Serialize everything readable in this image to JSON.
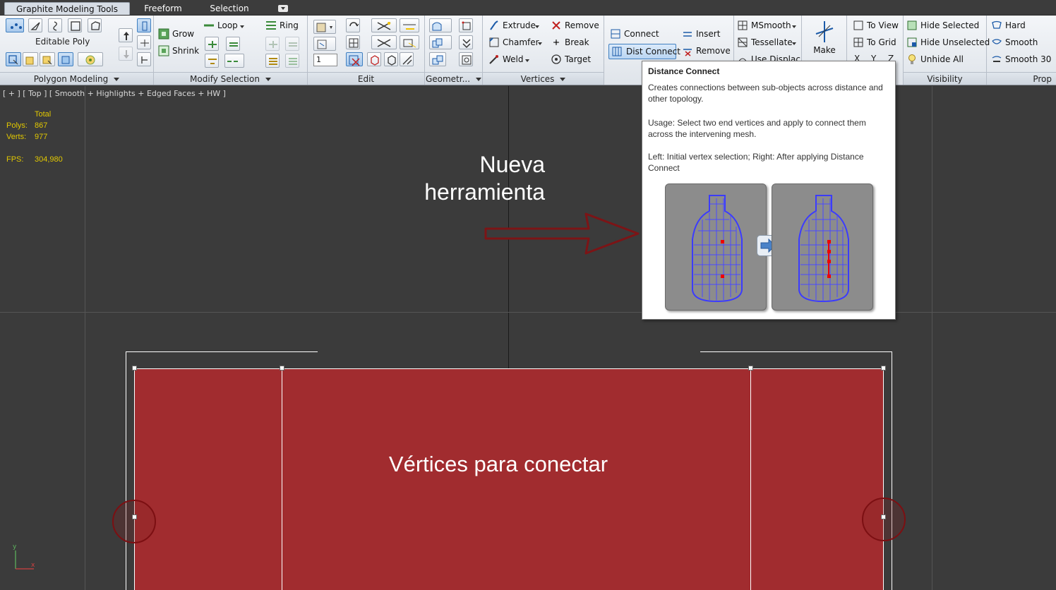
{
  "tabs": [
    {
      "label": "Graphite Modeling Tools",
      "active": true
    },
    {
      "label": "Freeform",
      "active": false
    },
    {
      "label": "Selection",
      "active": false
    }
  ],
  "ribbon": {
    "polygon_modeling": {
      "object_label": "Editable Poly",
      "footer": "Polygon Modeling"
    },
    "modify_selection": {
      "grow": "Grow",
      "shrink": "Shrink",
      "loop": "Loop",
      "ring": "Ring",
      "footer": "Modify Selection"
    },
    "edit": {
      "spinner_value": "1",
      "footer": "Edit"
    },
    "geometry": {
      "footer": "Geometr..."
    },
    "vertices": {
      "extrude": "Extrude",
      "chamfer": "Chamfer",
      "weld": "Weld",
      "remove": "Remove",
      "break": "Break",
      "target": "Target",
      "footer": "Vertices"
    },
    "loops": {
      "connect": "Connect",
      "dist_connect": "Dist Connect",
      "insert": "Insert",
      "remove": "Remove"
    },
    "subdivision": {
      "msmooth": "MSmooth",
      "tessellate": "Tessellate",
      "use_displace": "Use Displac..."
    },
    "align": {
      "make_label": "Make",
      "to_view": "To View",
      "to_grid": "To Grid",
      "x": "X",
      "y": "Y",
      "z": "Z"
    },
    "visibility": {
      "hide_selected": "Hide Selected",
      "hide_unselected": "Hide Unselected",
      "unhide_all": "Unhide All",
      "footer": "Visibility"
    },
    "properties": {
      "hard": "Hard",
      "smooth": "Smooth",
      "smooth30": "Smooth 30",
      "footer": "Prop"
    }
  },
  "viewport": {
    "label": "[ + ] [ Top ] [ Smooth + Highlights + Edged Faces + HW ]",
    "stats": {
      "total_label": "Total",
      "polys_label": "Polys:",
      "polys_value": "867",
      "verts_label": "Verts:",
      "verts_value": "977",
      "fps_label": "FPS:",
      "fps_value": "304,980"
    },
    "annotation_new_tool": "Nueva herramienta",
    "annotation_vertices": "Vértices para conectar",
    "axis_y": "y",
    "axis_x": "x"
  },
  "tooltip": {
    "title": "Distance Connect",
    "description": "Creates connections between sub-objects across distance and other topology.",
    "usage": "Usage: Select two end vertices and apply to connect them across the intervening mesh.",
    "caption": "Left: Initial vertex selection; Right: After applying Distance Connect"
  },
  "colors": {
    "shape_fill": "#a12c2f",
    "annotation_arrow": "#7c1416",
    "highlight": "#3f7fc0"
  }
}
